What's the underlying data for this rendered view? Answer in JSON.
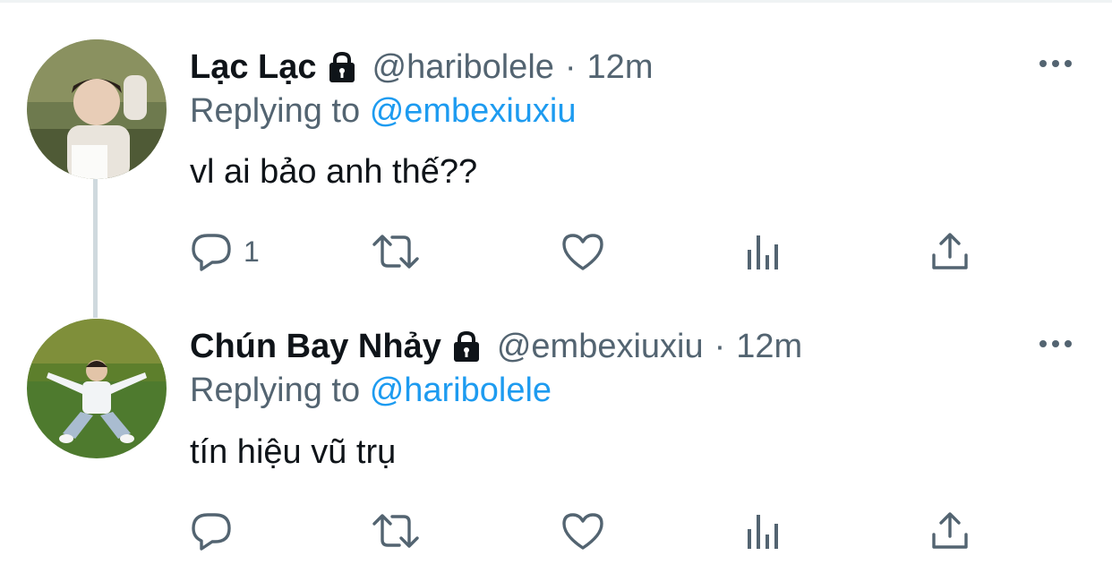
{
  "tweets": [
    {
      "display_name": "Lạc Lạc",
      "handle": "@haribolele",
      "separator": "·",
      "time": "12m",
      "replying_prefix": "Replying to",
      "replying_to": "@embexiuxiu",
      "text": "vl ai bảo anh thế??",
      "reply_count": "1",
      "avatar_icon": "avatar-photo",
      "protected_icon": "lock-icon"
    },
    {
      "display_name": "Chún Bay Nhảy",
      "handle": "@embexiuxiu",
      "separator": "·",
      "time": "12m",
      "replying_prefix": "Replying to",
      "replying_to": "@haribolele",
      "text": "tín hiệu vũ trụ",
      "reply_count": "",
      "avatar_icon": "avatar-photo",
      "protected_icon": "lock-icon"
    }
  ],
  "icons": {
    "reply": "reply-icon",
    "retweet": "retweet-icon",
    "like": "heart-icon",
    "analytics": "analytics-icon",
    "share": "share-icon",
    "more": "more-icon"
  },
  "colors": {
    "text_primary": "#0f1419",
    "text_secondary": "#536471",
    "link": "#1d9bf0",
    "thread_line": "#cfd9de"
  }
}
